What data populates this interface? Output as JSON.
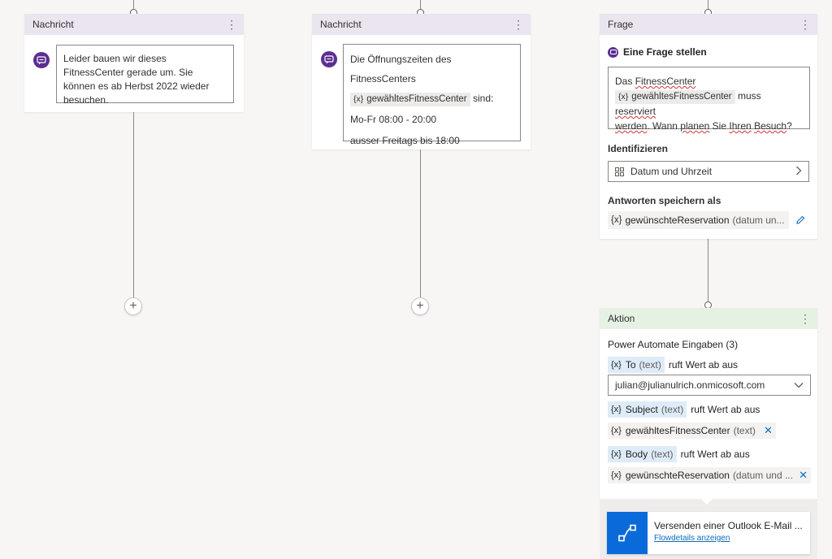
{
  "cards": {
    "msg1": {
      "header": "Nachricht",
      "text": "Leider bauen wir dieses FitnessCenter gerade um. Sie können es ab Herbst 2022 wieder besuchen."
    },
    "msg2": {
      "header": "Nachricht",
      "line1": "Die Öffnungszeiten des FitnessCenters",
      "var": "gewähltesFitnessCenter",
      "var_icon": "{x}",
      "after_var": "sind:",
      "line3": "Mo-Fr 08:00 - 20:00",
      "line4": "ausser Freitags bis 18:00"
    },
    "question": {
      "header": "Frage",
      "title": "Eine Frage stellen",
      "text_part1": "Das",
      "text_part2": "FitnessCenter",
      "var": "gewähltesFitnessCenter",
      "var_icon": "{x}",
      "text_part3": "muss",
      "text_part4": "reserviert",
      "text_part5": "werden",
      "text_part6": ". Wann",
      "text_part7": "planen",
      "text_part8": "Sie",
      "text_part9": "Ihren",
      "text_part10": "Besuch",
      "text_part11": "?",
      "identify_label": "Identifizieren",
      "identify_value": "Datum und Uhrzeit",
      "save_label": "Antworten speichern als",
      "save_var_icon": "{x}",
      "save_var": "gewünschteReservation",
      "save_type": "(datum un..."
    },
    "action": {
      "header": "Aktion",
      "inputs_label": "Power Automate Eingaben (3)",
      "to_icon": "{x}",
      "to_name": "To",
      "to_type": "(text)",
      "to_suffix": "ruft Wert ab aus",
      "to_value": "julian@julianulrich.onmicosoft.com",
      "subject_icon": "{x}",
      "subject_name": "Subject",
      "subject_type": "(text)",
      "subject_suffix": "ruft Wert ab aus",
      "subject_var_icon": "{x}",
      "subject_var": "gewähltesFitnessCenter",
      "subject_var_type": "(text)",
      "body_icon": "{x}",
      "body_name": "Body",
      "body_type": "(text)",
      "body_suffix": "ruft Wert ab aus",
      "body_var_icon": "{x}",
      "body_var": "gewünschteReservation",
      "body_var_type": "(datum und ...",
      "flow_title": "Versenden einer Outlook E-Mail ...",
      "flow_link": "Flowdetails anzeigen"
    }
  },
  "icons": {
    "message": "chat-bubble-icon",
    "more": "more-vertical-icon",
    "chevron_right": "chevron-right-icon",
    "chevron_down": "chevron-down-icon",
    "edit": "pencil-icon",
    "close": "close-icon",
    "add": "plus-icon",
    "calendar": "calendar-grid-icon",
    "flow": "power-automate-icon"
  },
  "colors": {
    "message_accent": "#5c2e91",
    "question_header": "#ebe5f0",
    "action_header": "#e5f1e3",
    "var_tag_blue": "#deecf9",
    "flow_blue": "#0b6ad9",
    "link": "#0f6cbd"
  }
}
